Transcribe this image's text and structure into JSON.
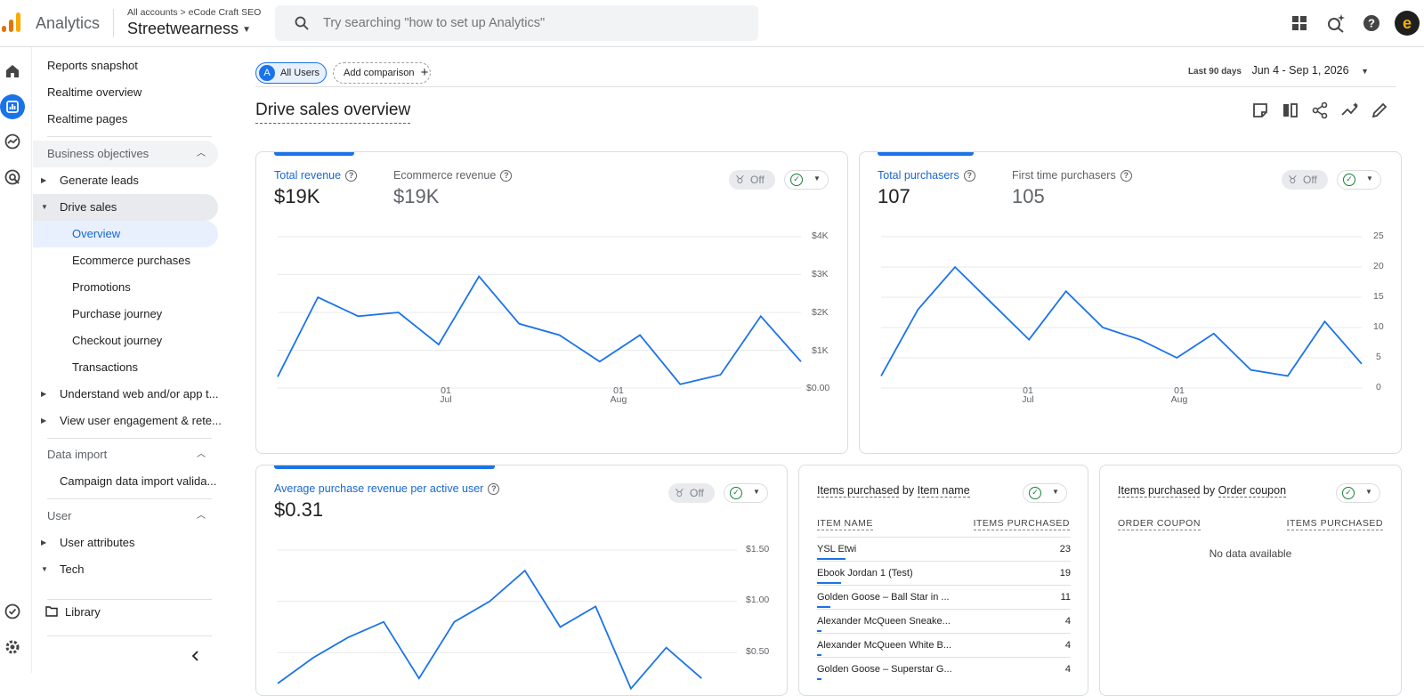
{
  "header": {
    "app_name": "Analytics",
    "breadcrumb_all": "All accounts",
    "breadcrumb_sep": ">",
    "breadcrumb_account": "eCode Craft SEO",
    "property": "Streetwearness",
    "search_placeholder": "Try searching \"how to set up Analytics\""
  },
  "sidebar": {
    "top_items": [
      "Reports snapshot",
      "Realtime overview",
      "Realtime pages"
    ],
    "business_objectives": "Business objectives",
    "generate_leads": "Generate leads",
    "drive_sales": "Drive sales",
    "drive_sales_items": [
      "Overview",
      "Ecommerce purchases",
      "Promotions",
      "Purchase journey",
      "Checkout journey",
      "Transactions"
    ],
    "understand": "Understand web and/or app t...",
    "engagement": "View user engagement & rete...",
    "data_import": "Data import",
    "campaign_import": "Campaign data import valida...",
    "user": "User",
    "user_attributes": "User attributes",
    "tech": "Tech",
    "library": "Library"
  },
  "toolbar": {
    "segment_letter": "A",
    "segment_label": "All Users",
    "add_comparison": "Add comparison",
    "date_label": "Last 90 days",
    "date_range": "Jun 4 - Sep 1, 2026",
    "page_title": "Drive sales overview"
  },
  "cards": {
    "revenue": {
      "metric1_label": "Total revenue",
      "metric1_value": "$19K",
      "metric2_label": "Ecommerce revenue",
      "metric2_value": "$19K",
      "off_label": "Off",
      "y_ticks": [
        "$4K",
        "$3K",
        "$2K",
        "$1K",
        "$0.00"
      ],
      "x_ticks": [
        {
          "d": "01",
          "m": "Jul"
        },
        {
          "d": "01",
          "m": "Aug"
        }
      ]
    },
    "purchasers": {
      "metric1_label": "Total purchasers",
      "metric1_value": "107",
      "metric2_label": "First time purchasers",
      "metric2_value": "105",
      "off_label": "Off",
      "y_ticks": [
        "25",
        "20",
        "15",
        "10",
        "5",
        "0"
      ],
      "x_ticks": [
        {
          "d": "01",
          "m": "Jul"
        },
        {
          "d": "01",
          "m": "Aug"
        }
      ]
    },
    "arpu": {
      "metric1_label": "Average purchase revenue per active user",
      "metric1_value": "$0.31",
      "off_label": "Off",
      "y_ticks": [
        "$1.50",
        "$1.00",
        "$0.50"
      ]
    },
    "items_by_name": {
      "title_a": "Items purchased",
      "title_by": "by",
      "title_b": "Item name",
      "col1": "ITEM NAME",
      "col2": "ITEMS PURCHASED",
      "rows": [
        {
          "name": "YSL Etwi",
          "value": "23",
          "share": 1.0
        },
        {
          "name": "Ebook Jordan 1 (Test)",
          "value": "19",
          "share": 0.83
        },
        {
          "name": "Golden Goose – Ball Star in ...",
          "value": "11",
          "share": 0.48
        },
        {
          "name": "Alexander McQueen Sneake...",
          "value": "4",
          "share": 0.17
        },
        {
          "name": "Alexander McQueen White B...",
          "value": "4",
          "share": 0.17
        },
        {
          "name": "Golden Goose – Superstar G...",
          "value": "4",
          "share": 0.17
        }
      ]
    },
    "items_by_coupon": {
      "title_a": "Items purchased",
      "title_by": "by",
      "title_b": "Order coupon",
      "col1": "ORDER COUPON",
      "col2": "ITEMS PURCHASED",
      "empty": "No data available"
    }
  },
  "chart_data": [
    {
      "type": "line",
      "title": "Total revenue",
      "x": [
        "Jun 4",
        "Jun 10",
        "Jun 17",
        "Jun 24",
        "Jul 1",
        "Jul 7",
        "Jul 14",
        "Jul 21",
        "Jul 28",
        "Aug 4",
        "Aug 11",
        "Aug 18",
        "Aug 25",
        "Sep 1"
      ],
      "series": [
        {
          "name": "Total revenue",
          "values": [
            300,
            2400,
            1900,
            2000,
            1150,
            2950,
            1700,
            1400,
            700,
            1400,
            100,
            350,
            1900,
            700
          ]
        }
      ],
      "ylim": [
        0,
        4000
      ]
    },
    {
      "type": "line",
      "title": "Total purchasers",
      "x": [
        "Jun 4",
        "Jun 10",
        "Jun 17",
        "Jun 24",
        "Jul 1",
        "Jul 7",
        "Jul 14",
        "Jul 21",
        "Jul 28",
        "Aug 4",
        "Aug 11",
        "Aug 18",
        "Aug 25",
        "Sep 1"
      ],
      "series": [
        {
          "name": "Total purchasers",
          "values": [
            2,
            13,
            20,
            14,
            8,
            16,
            10,
            8,
            5,
            9,
            3,
            2,
            11,
            4
          ]
        }
      ],
      "ylim": [
        0,
        25
      ]
    },
    {
      "type": "line",
      "title": "Average purchase revenue per active user",
      "x": [
        "Jun 4",
        "Jun 10",
        "Jun 17",
        "Jun 24",
        "Jul 1",
        "Jul 7",
        "Jul 14",
        "Jul 21",
        "Jul 28",
        "Aug 4",
        "Aug 11",
        "Aug 18",
        "Aug 25"
      ],
      "series": [
        {
          "name": "Average purchase revenue per active user",
          "values": [
            0.2,
            0.45,
            0.65,
            0.8,
            0.25,
            0.8,
            1.0,
            1.3,
            0.75,
            0.95,
            0.15,
            0.55,
            0.25
          ]
        }
      ],
      "ylim": [
        0,
        1.5
      ]
    }
  ]
}
